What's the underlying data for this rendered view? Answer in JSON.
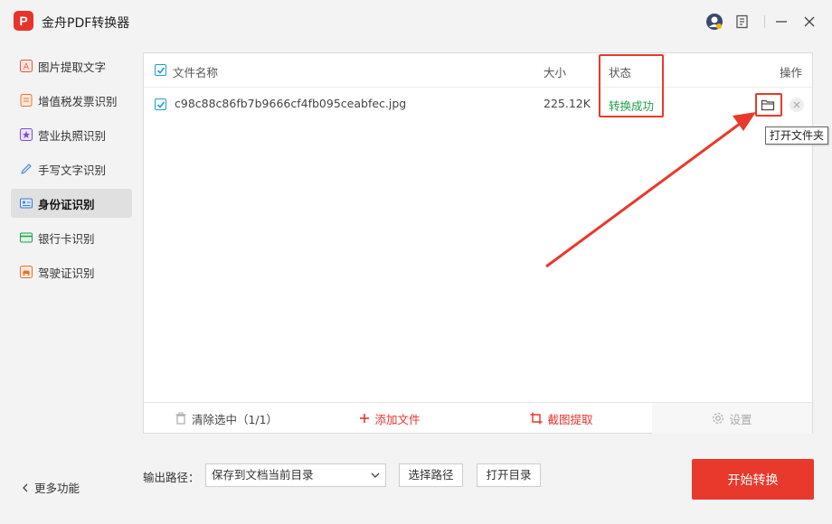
{
  "app": {
    "title": "金舟PDF转换器",
    "logo_letter": "P"
  },
  "titlebar_icons": [
    "avatar-icon",
    "feedback-icon",
    "minimize-icon",
    "close-icon"
  ],
  "sidebar": {
    "items": [
      {
        "label": "图片提取文字",
        "icon": "image-text-icon",
        "color": "#e05a3a"
      },
      {
        "label": "增值税发票识别",
        "icon": "invoice-icon",
        "color": "#e8732c"
      },
      {
        "label": "营业执照识别",
        "icon": "license-icon",
        "color": "#7a4fd1"
      },
      {
        "label": "手写文字识别",
        "icon": "pen-icon",
        "color": "#3a7bd5"
      },
      {
        "label": "身份证识别",
        "icon": "id-card-icon",
        "color": "#3a7bd5",
        "active": true
      },
      {
        "label": "银行卡识别",
        "icon": "bank-card-icon",
        "color": "#21a048"
      },
      {
        "label": "驾驶证识别",
        "icon": "car-icon",
        "color": "#e8732c"
      }
    ],
    "more_label": "更多功能"
  },
  "table": {
    "headers": {
      "name": "文件名称",
      "size": "大小",
      "status": "状态",
      "action": "操作"
    },
    "rows": [
      {
        "name": "c98c88c86fb7b9666cf4fb095ceabfec.jpg",
        "size": "225.12K",
        "status": "转换成功",
        "checked": true
      }
    ]
  },
  "tooltip": "打开文件夹",
  "actions": {
    "clear": "清除选中（1/1）",
    "add": "添加文件",
    "crop": "截图提取",
    "settings": "设置"
  },
  "output": {
    "label": "输出路径：",
    "path": "保存到文档当前目录",
    "choose": "选择路径",
    "open": "打开目录"
  },
  "start_label": "开始转换",
  "colors": {
    "accent": "#e8392c",
    "success": "#21a048",
    "checkbox": "#1e9bd7"
  }
}
